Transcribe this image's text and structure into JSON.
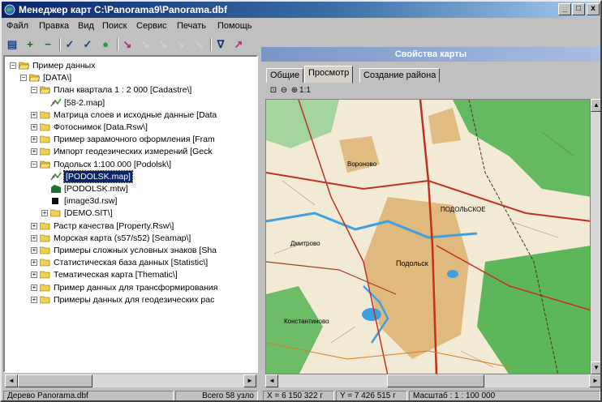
{
  "window": {
    "title": "Менеджер карт C:\\Panorama9\\Panorama.dbf",
    "min_label": "_",
    "max_label": "□",
    "close_label": "x",
    "accent": "#0a246a"
  },
  "menu": [
    "Файл",
    "Правка",
    "Вид",
    "Поиск",
    "Сервис",
    "Печать",
    "Помощь"
  ],
  "toolbar": {
    "tools": [
      {
        "icon": "properties-icon",
        "glyph": "▤",
        "enabled": true
      },
      {
        "icon": "add-icon",
        "glyph": "+",
        "enabled": true
      },
      {
        "icon": "remove-icon",
        "glyph": "−",
        "enabled": true
      },
      {
        "icon": "check-icon",
        "glyph": "✓",
        "enabled": true
      },
      {
        "icon": "check-all-icon",
        "glyph": "✓",
        "enabled": true
      },
      {
        "icon": "globe-icon",
        "glyph": "●",
        "enabled": true
      },
      {
        "icon": "pin-icon",
        "glyph": "↘",
        "enabled": true
      },
      {
        "icon": "pin-disabled-icon",
        "glyph": "↘",
        "enabled": false
      },
      {
        "icon": "pin-disabled-icon",
        "glyph": "↘",
        "enabled": false
      },
      {
        "icon": "pin-disabled-icon",
        "glyph": "↘",
        "enabled": false
      },
      {
        "icon": "pin-disabled-icon",
        "glyph": "↘",
        "enabled": false
      },
      {
        "icon": "filter-icon",
        "glyph": "∇",
        "enabled": true
      },
      {
        "icon": "open-map-icon",
        "glyph": "↗",
        "enabled": true
      }
    ]
  },
  "tree": [
    {
      "label": "Пример данных",
      "type": "folder-open",
      "level": 0,
      "expander": "−"
    },
    {
      "label": "[DATA\\]",
      "type": "folder-open",
      "level": 1,
      "expander": "−"
    },
    {
      "label": "План квартала 1 : 2 000 [Cadastre\\]",
      "type": "folder-open",
      "level": 2,
      "expander": "−"
    },
    {
      "label": "[58-2.map]",
      "type": "map",
      "level": 3,
      "expander": ""
    },
    {
      "label": "Матрица слоев и исходные данные [Data",
      "type": "folder",
      "level": 2,
      "expander": "+"
    },
    {
      "label": "Фотоснимок [Data.Rsw\\]",
      "type": "folder",
      "level": 2,
      "expander": "+"
    },
    {
      "label": "Пример зарамочного оформления [Fram",
      "type": "folder",
      "level": 2,
      "expander": "+"
    },
    {
      "label": "Импорт геодезических измерений [Geck",
      "type": "folder",
      "level": 2,
      "expander": "+"
    },
    {
      "label": "Подольск 1:100 000 [Podolsk\\]",
      "type": "folder-open",
      "level": 2,
      "expander": "−"
    },
    {
      "label": "[PODOLSK.map]",
      "type": "map",
      "level": 3,
      "expander": "",
      "selected": true
    },
    {
      "label": "[PODOLSK.mtw]",
      "type": "matrix",
      "level": 3,
      "expander": ""
    },
    {
      "label": "[image3d.rsw]",
      "type": "raster",
      "level": 3,
      "expander": ""
    },
    {
      "label": "[DEMO.SIT\\]",
      "type": "folder",
      "level": 3,
      "expander": "+"
    },
    {
      "label": "Растр качества [Property.Rsw\\]",
      "type": "folder",
      "level": 2,
      "expander": "+"
    },
    {
      "label": "Морская карта (s57/s52) [Seamap\\]",
      "type": "folder",
      "level": 2,
      "expander": "+"
    },
    {
      "label": "Примеры сложных условных знаков [Sha",
      "type": "folder",
      "level": 2,
      "expander": "+"
    },
    {
      "label": "Статистическая база данных [Statistic\\]",
      "type": "folder",
      "level": 2,
      "expander": "+"
    },
    {
      "label": "Тематическая карта [Thematic\\]",
      "type": "folder",
      "level": 2,
      "expander": "+"
    },
    {
      "label": "Пример данных для трансформирования",
      "type": "folder",
      "level": 2,
      "expander": "+"
    },
    {
      "label": "Примеры данных для геодезических рас",
      "type": "folder",
      "level": 2,
      "expander": "+"
    }
  ],
  "status_left": {
    "tree_name": "Дерево Panorama.dbf",
    "count": "Всего 58 узло"
  },
  "panel": {
    "title": "Свойства карты",
    "tabs": [
      "Общие",
      "Просмотр",
      "Создание района"
    ],
    "active_tab": "Просмотр",
    "zoom_tools": [
      {
        "icon": "zoom-fit-icon",
        "glyph": "⊡"
      },
      {
        "icon": "zoom-out-icon",
        "glyph": "⊖"
      },
      {
        "icon": "zoom-in-icon",
        "glyph": "⊕"
      },
      {
        "icon": "zoom-actual-icon",
        "glyph": "1:1"
      }
    ],
    "map_labels": [
      "Подольск",
      "ПОДОЛЬСКОЕ",
      "Константиново",
      "Дмитрово",
      "Вороново"
    ]
  },
  "status_right": {
    "x": "X = 6 150 322 г",
    "y": "Y = 7 426 515 г",
    "scale": "Масштаб :   1 : 100 000"
  },
  "colors": {
    "forest": "#4cb04c",
    "urban": "#d8a860",
    "water": "#3ea0e0",
    "road": "#c03020"
  }
}
